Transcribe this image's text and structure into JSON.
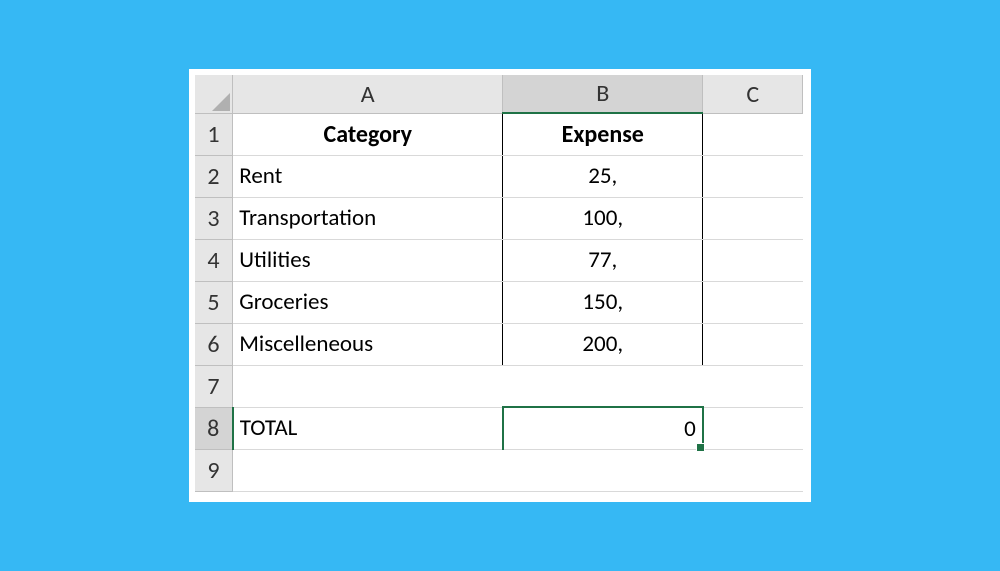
{
  "columns": [
    "A",
    "B",
    "C"
  ],
  "row_numbers": [
    "1",
    "2",
    "3",
    "4",
    "5",
    "6",
    "7",
    "8",
    "9"
  ],
  "headers": {
    "a": "Category",
    "b": "Expense"
  },
  "rows": [
    {
      "category": "Rent",
      "expense": "25,"
    },
    {
      "category": "Transportation",
      "expense": "100,"
    },
    {
      "category": "Utilities",
      "expense": "77,"
    },
    {
      "category": "Groceries",
      "expense": "150,"
    },
    {
      "category": "Miscelleneous",
      "expense": "200,"
    }
  ],
  "total": {
    "label": "TOTAL",
    "value": "0"
  },
  "selected_cell": "B8",
  "chart_data": {
    "type": "table",
    "title": "",
    "columns": [
      "Category",
      "Expense"
    ],
    "data": [
      [
        "Rent",
        "25,"
      ],
      [
        "Transportation",
        "100,"
      ],
      [
        "Utilities",
        "77,"
      ],
      [
        "Groceries",
        "150,"
      ],
      [
        "Miscelleneous",
        "200,"
      ]
    ],
    "footer": [
      "TOTAL",
      0
    ]
  }
}
